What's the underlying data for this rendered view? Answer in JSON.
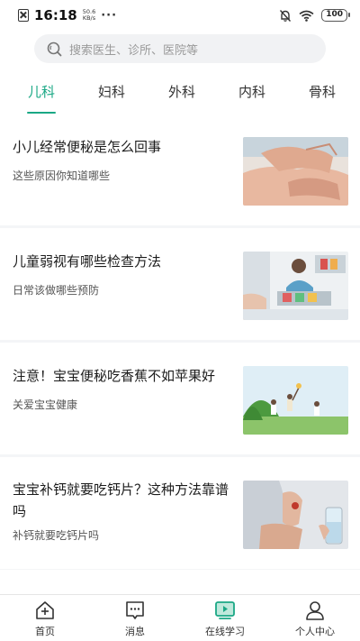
{
  "status_bar": {
    "time": "16:18",
    "net_speed_value": "50.6",
    "net_speed_unit": "KB/s",
    "more": "···",
    "battery": "100",
    "icons": [
      "close-notification-icon",
      "mute-bell-icon",
      "wifi-icon",
      "battery-icon"
    ]
  },
  "search": {
    "placeholder": "搜索医生、诊所、医院等",
    "icon": "search-icon"
  },
  "tabs": [
    {
      "label": "儿科",
      "active": true
    },
    {
      "label": "妇科",
      "active": false
    },
    {
      "label": "外科",
      "active": false
    },
    {
      "label": "内科",
      "active": false
    },
    {
      "label": "骨科",
      "active": false
    }
  ],
  "articles": [
    {
      "title": "小儿经常便秘是怎么回事",
      "subtitle": "这些原因你知道哪些",
      "image": "hands-massage-photo"
    },
    {
      "title": "儿童弱视有哪些检查方法",
      "subtitle": "日常该做哪些预防",
      "image": "eye-exam-clinic-photo"
    },
    {
      "title": "注意！宝宝便秘吃香蕉不如苹果好",
      "subtitle": "关爱宝宝健康",
      "image": "children-playing-outdoors-photo"
    },
    {
      "title": "宝宝补钙就要吃钙片？这种方法靠谱吗",
      "subtitle": "补钙就要吃钙片吗",
      "image": "taking-pill-with-water-photo"
    }
  ],
  "bottom_nav": [
    {
      "label": "首页",
      "icon": "home-icon",
      "active": false
    },
    {
      "label": "消息",
      "icon": "message-icon",
      "active": false
    },
    {
      "label": "在线学习",
      "icon": "video-play-icon",
      "active": true
    },
    {
      "label": "个人中心",
      "icon": "person-icon",
      "active": false
    }
  ],
  "colors": {
    "accent": "#1aa885",
    "background": "#f4f5f7"
  }
}
